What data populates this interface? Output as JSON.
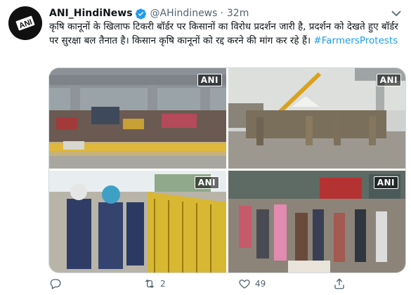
{
  "tweet": {
    "author_name": "ANI_HindiNews",
    "handle": "@AHindinews",
    "separator": "·",
    "time": "32m",
    "avatar_text": "ANI",
    "text": "कृषि कानूनों के खिलाफ टिकरी बॉर्डर पर किसानों का विरोध प्रदर्शन जारी है, प्रदर्शन को देखते हुए बॉर्डर पर सुरक्षा बल तैनात है। किसान कृषि कानूनों को रद्द करने की मांग कर रहे हैं।",
    "hashtag": "#FarmersProtests",
    "photo_watermark": "ANI",
    "retweet_count": "2",
    "like_count": "49"
  },
  "colors": {
    "accent": "#1d9bf0",
    "secondary_text": "#536471",
    "primary_text": "#0f1419",
    "border": "#cfd9de"
  },
  "icons": {
    "verified": "verified-badge-icon",
    "more": "chevron-down-icon",
    "reply": "reply-icon",
    "retweet": "retweet-icon",
    "like": "heart-icon",
    "share": "share-icon"
  }
}
